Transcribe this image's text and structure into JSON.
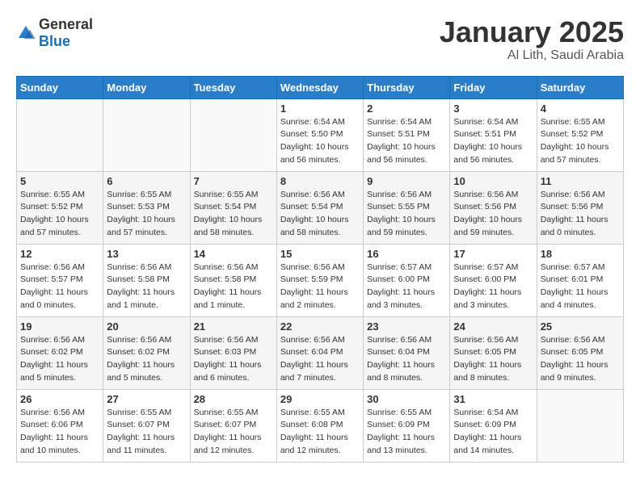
{
  "logo": {
    "general": "General",
    "blue": "Blue"
  },
  "title": "January 2025",
  "subtitle": "Al Lith, Saudi Arabia",
  "days_of_week": [
    "Sunday",
    "Monday",
    "Tuesday",
    "Wednesday",
    "Thursday",
    "Friday",
    "Saturday"
  ],
  "weeks": [
    [
      {
        "num": "",
        "info": ""
      },
      {
        "num": "",
        "info": ""
      },
      {
        "num": "",
        "info": ""
      },
      {
        "num": "1",
        "info": "Sunrise: 6:54 AM\nSunset: 5:50 PM\nDaylight: 10 hours\nand 56 minutes."
      },
      {
        "num": "2",
        "info": "Sunrise: 6:54 AM\nSunset: 5:51 PM\nDaylight: 10 hours\nand 56 minutes."
      },
      {
        "num": "3",
        "info": "Sunrise: 6:54 AM\nSunset: 5:51 PM\nDaylight: 10 hours\nand 56 minutes."
      },
      {
        "num": "4",
        "info": "Sunrise: 6:55 AM\nSunset: 5:52 PM\nDaylight: 10 hours\nand 57 minutes."
      }
    ],
    [
      {
        "num": "5",
        "info": "Sunrise: 6:55 AM\nSunset: 5:52 PM\nDaylight: 10 hours\nand 57 minutes."
      },
      {
        "num": "6",
        "info": "Sunrise: 6:55 AM\nSunset: 5:53 PM\nDaylight: 10 hours\nand 57 minutes."
      },
      {
        "num": "7",
        "info": "Sunrise: 6:55 AM\nSunset: 5:54 PM\nDaylight: 10 hours\nand 58 minutes."
      },
      {
        "num": "8",
        "info": "Sunrise: 6:56 AM\nSunset: 5:54 PM\nDaylight: 10 hours\nand 58 minutes."
      },
      {
        "num": "9",
        "info": "Sunrise: 6:56 AM\nSunset: 5:55 PM\nDaylight: 10 hours\nand 59 minutes."
      },
      {
        "num": "10",
        "info": "Sunrise: 6:56 AM\nSunset: 5:56 PM\nDaylight: 10 hours\nand 59 minutes."
      },
      {
        "num": "11",
        "info": "Sunrise: 6:56 AM\nSunset: 5:56 PM\nDaylight: 11 hours\nand 0 minutes."
      }
    ],
    [
      {
        "num": "12",
        "info": "Sunrise: 6:56 AM\nSunset: 5:57 PM\nDaylight: 11 hours\nand 0 minutes."
      },
      {
        "num": "13",
        "info": "Sunrise: 6:56 AM\nSunset: 5:58 PM\nDaylight: 11 hours\nand 1 minute."
      },
      {
        "num": "14",
        "info": "Sunrise: 6:56 AM\nSunset: 5:58 PM\nDaylight: 11 hours\nand 1 minute."
      },
      {
        "num": "15",
        "info": "Sunrise: 6:56 AM\nSunset: 5:59 PM\nDaylight: 11 hours\nand 2 minutes."
      },
      {
        "num": "16",
        "info": "Sunrise: 6:57 AM\nSunset: 6:00 PM\nDaylight: 11 hours\nand 3 minutes."
      },
      {
        "num": "17",
        "info": "Sunrise: 6:57 AM\nSunset: 6:00 PM\nDaylight: 11 hours\nand 3 minutes."
      },
      {
        "num": "18",
        "info": "Sunrise: 6:57 AM\nSunset: 6:01 PM\nDaylight: 11 hours\nand 4 minutes."
      }
    ],
    [
      {
        "num": "19",
        "info": "Sunrise: 6:56 AM\nSunset: 6:02 PM\nDaylight: 11 hours\nand 5 minutes."
      },
      {
        "num": "20",
        "info": "Sunrise: 6:56 AM\nSunset: 6:02 PM\nDaylight: 11 hours\nand 5 minutes."
      },
      {
        "num": "21",
        "info": "Sunrise: 6:56 AM\nSunset: 6:03 PM\nDaylight: 11 hours\nand 6 minutes."
      },
      {
        "num": "22",
        "info": "Sunrise: 6:56 AM\nSunset: 6:04 PM\nDaylight: 11 hours\nand 7 minutes."
      },
      {
        "num": "23",
        "info": "Sunrise: 6:56 AM\nSunset: 6:04 PM\nDaylight: 11 hours\nand 8 minutes."
      },
      {
        "num": "24",
        "info": "Sunrise: 6:56 AM\nSunset: 6:05 PM\nDaylight: 11 hours\nand 8 minutes."
      },
      {
        "num": "25",
        "info": "Sunrise: 6:56 AM\nSunset: 6:05 PM\nDaylight: 11 hours\nand 9 minutes."
      }
    ],
    [
      {
        "num": "26",
        "info": "Sunrise: 6:56 AM\nSunset: 6:06 PM\nDaylight: 11 hours\nand 10 minutes."
      },
      {
        "num": "27",
        "info": "Sunrise: 6:55 AM\nSunset: 6:07 PM\nDaylight: 11 hours\nand 11 minutes."
      },
      {
        "num": "28",
        "info": "Sunrise: 6:55 AM\nSunset: 6:07 PM\nDaylight: 11 hours\nand 12 minutes."
      },
      {
        "num": "29",
        "info": "Sunrise: 6:55 AM\nSunset: 6:08 PM\nDaylight: 11 hours\nand 12 minutes."
      },
      {
        "num": "30",
        "info": "Sunrise: 6:55 AM\nSunset: 6:09 PM\nDaylight: 11 hours\nand 13 minutes."
      },
      {
        "num": "31",
        "info": "Sunrise: 6:54 AM\nSunset: 6:09 PM\nDaylight: 11 hours\nand 14 minutes."
      },
      {
        "num": "",
        "info": ""
      }
    ]
  ]
}
